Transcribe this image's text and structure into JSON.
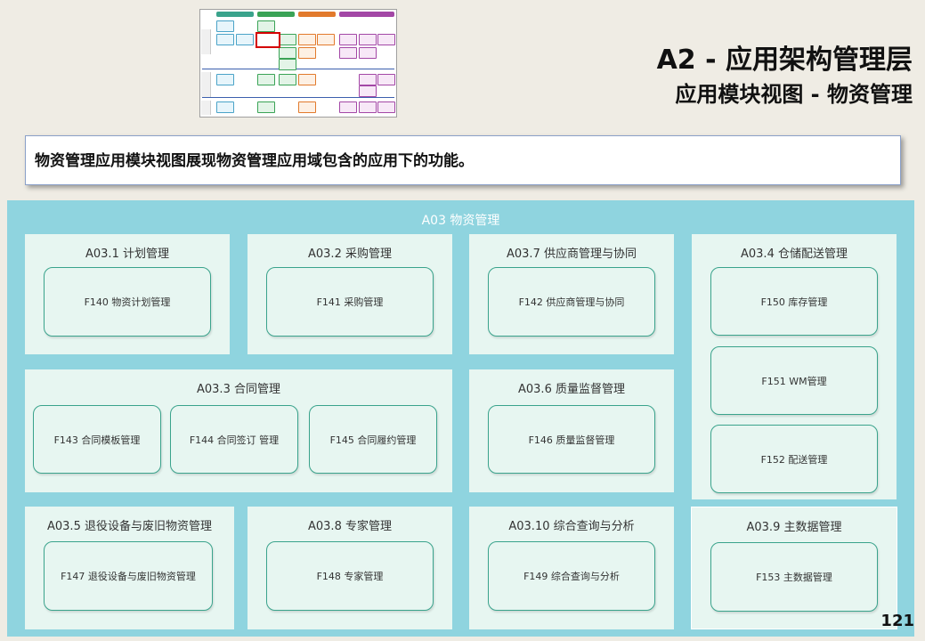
{
  "title": {
    "main": "A2 - 应用架构管理层",
    "sub": "应用模块视图 - 物资管理"
  },
  "description": "物资管理应用模块视图展现物资管理应用域包含的应用下的功能。",
  "domain": {
    "title": "A03 物资管理",
    "groups": [
      {
        "title": "A03.1 计划管理",
        "functions": [
          "F140 物资计划管理"
        ]
      },
      {
        "title": "A03.2 采购管理",
        "functions": [
          "F141 采购管理"
        ]
      },
      {
        "title": "A03.7 供应商管理与协同",
        "functions": [
          "F142 供应商管理与协同"
        ]
      },
      {
        "title": "A03.4 仓储配送管理",
        "functions": [
          "F150 库存管理",
          "F151 WM管理",
          "F152 配送管理"
        ]
      },
      {
        "title": "A03.3 合同管理",
        "functions": [
          "F143 合同模板管理",
          "F144 合同签订 管理",
          "F145 合同履约管理"
        ]
      },
      {
        "title": "A03.6 质量监督管理",
        "functions": [
          "F146 质量监督管理"
        ]
      },
      {
        "title": "A03.5 退役设备与废旧物资管理",
        "functions": [
          "F147 退役设备与废旧物资管理"
        ]
      },
      {
        "title": "A03.8 专家管理",
        "functions": [
          "F148 专家管理"
        ]
      },
      {
        "title": "A03.10 综合查询与分析",
        "functions": [
          "F149 综合查询与分析"
        ]
      },
      {
        "title": "A03.9 主数据管理",
        "functions": [
          "F153 主数据管理"
        ]
      }
    ]
  },
  "colors": {
    "domain_bg": "#8fd4df",
    "group_bg": "#e7f6f1",
    "function_border": "#3aa38c",
    "thumbnail_highlight": "#d40000"
  },
  "page_number": "121"
}
